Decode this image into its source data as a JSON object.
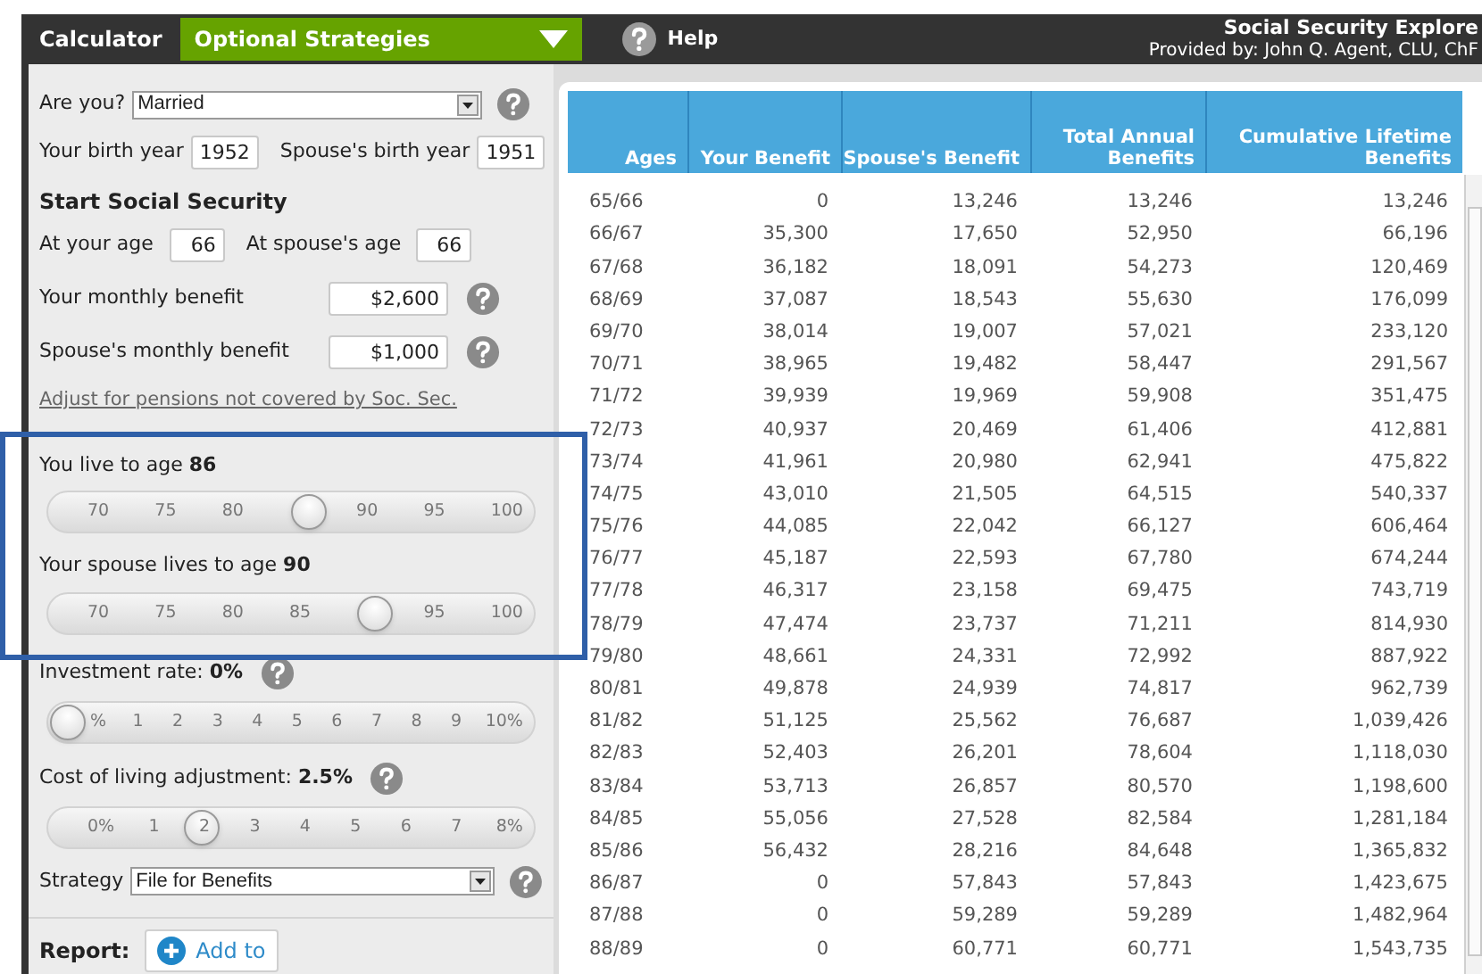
{
  "top_bar": {
    "calculator_label": "Calculator",
    "mode_select": "Optional Strategies",
    "help": "Help",
    "app_title": "Social Security Explore",
    "provided_by": "Provided by: John Q. Agent, CLU, ChF"
  },
  "form": {
    "marital": {
      "label": "Are you?",
      "value": "Married"
    },
    "your_birth_year": {
      "label": "Your birth year",
      "value": "1952"
    },
    "spouse_birth_year": {
      "label": "Spouse's birth year",
      "value": "1951"
    },
    "start_heading": "Start Social Security",
    "your_age": {
      "label": "At your age",
      "value": "66"
    },
    "spouse_age": {
      "label": "At spouse's age",
      "value": "66"
    },
    "your_benefit": {
      "label": "Your monthly benefit",
      "value": "$2,600"
    },
    "spouse_benefit": {
      "label": "Spouse's monthly benefit",
      "value": "$1,000"
    },
    "pension_link": "Adjust for pensions not covered by Soc. Sec.",
    "sliders": [
      {
        "label": "You live to age",
        "value": "86",
        "help_icon": false,
        "level": 0.533,
        "thumb_covers_tick": true,
        "ticks": [
          "70",
          "75",
          "80",
          "90",
          "95",
          "100"
        ]
      },
      {
        "label": "Your spouse lives to age",
        "value": "90",
        "help_icon": false,
        "level": 0.667,
        "thumb_covers_tick": true,
        "ticks": [
          "70",
          "75",
          "80",
          "85",
          "95",
          "100"
        ]
      },
      {
        "label": "Investment rate:",
        "value": "0%",
        "help_icon": true,
        "level": 0,
        "thumb_covers_tick": false,
        "ticks": [
          "%",
          "1",
          "2",
          "3",
          "4",
          "5",
          "6",
          "7",
          "8",
          "9",
          "10%"
        ]
      },
      {
        "label": "Cost of living adjustment:",
        "value": "2.5%",
        "help_icon": true,
        "level": 0.3125,
        "thumb_covers_tick": false,
        "ticks": [
          "0%",
          "1",
          "2",
          "3",
          "4",
          "5",
          "6",
          "7",
          "8%"
        ]
      }
    ],
    "strategy": {
      "label": "Strategy",
      "value": "File for Benefits"
    },
    "report": {
      "label": "Report:",
      "button": "Add to"
    }
  },
  "table": {
    "columns": [
      "Ages",
      "Your Benefit",
      "Spouse's Benefit",
      "Total Annual Benefits",
      "Cumulative Lifetime Benefits"
    ],
    "rows": [
      [
        "65/66",
        "0",
        "13,246",
        "13,246",
        "13,246"
      ],
      [
        "66/67",
        "35,300",
        "17,650",
        "52,950",
        "66,196"
      ],
      [
        "67/68",
        "36,182",
        "18,091",
        "54,273",
        "120,469"
      ],
      [
        "68/69",
        "37,087",
        "18,543",
        "55,630",
        "176,099"
      ],
      [
        "69/70",
        "38,014",
        "19,007",
        "57,021",
        "233,120"
      ],
      [
        "70/71",
        "38,965",
        "19,482",
        "58,447",
        "291,567"
      ],
      [
        "71/72",
        "39,939",
        "19,969",
        "59,908",
        "351,475"
      ],
      [
        "72/73",
        "40,937",
        "20,469",
        "61,406",
        "412,881"
      ],
      [
        "73/74",
        "41,961",
        "20,980",
        "62,941",
        "475,822"
      ],
      [
        "74/75",
        "43,010",
        "21,505",
        "64,515",
        "540,337"
      ],
      [
        "75/76",
        "44,085",
        "22,042",
        "66,127",
        "606,464"
      ],
      [
        "76/77",
        "45,187",
        "22,593",
        "67,780",
        "674,244"
      ],
      [
        "77/78",
        "46,317",
        "23,158",
        "69,475",
        "743,719"
      ],
      [
        "78/79",
        "47,474",
        "23,737",
        "71,211",
        "814,930"
      ],
      [
        "79/80",
        "48,661",
        "24,331",
        "72,992",
        "887,922"
      ],
      [
        "80/81",
        "49,878",
        "24,939",
        "74,817",
        "962,739"
      ],
      [
        "81/82",
        "51,125",
        "25,562",
        "76,687",
        "1,039,426"
      ],
      [
        "82/83",
        "52,403",
        "26,201",
        "78,604",
        "1,118,030"
      ],
      [
        "83/84",
        "53,713",
        "26,857",
        "80,570",
        "1,198,600"
      ],
      [
        "84/85",
        "55,056",
        "27,528",
        "82,584",
        "1,281,184"
      ],
      [
        "85/86",
        "56,432",
        "28,216",
        "84,648",
        "1,365,832"
      ],
      [
        "86/87",
        "0",
        "57,843",
        "57,843",
        "1,423,675"
      ],
      [
        "87/88",
        "0",
        "59,289",
        "59,289",
        "1,482,964"
      ],
      [
        "88/89",
        "0",
        "60,771",
        "60,771",
        "1,543,735"
      ]
    ]
  }
}
